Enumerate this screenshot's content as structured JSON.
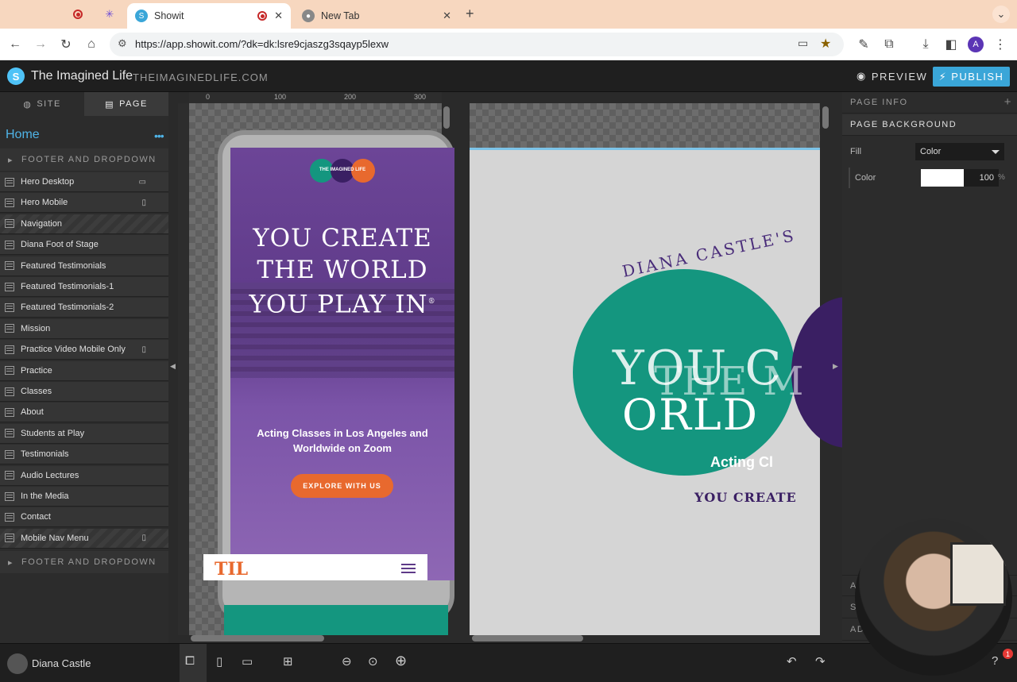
{
  "browser": {
    "tabs": [
      {
        "title": "Showit",
        "active": true
      },
      {
        "title": "New Tab",
        "active": false
      }
    ],
    "url": "https://app.showit.com/?dk=dk:lsre9cjaszg3sqayp5lexw",
    "profile_initial": "A",
    "new_tab_label": "+",
    "tab_menu_label": "⌄"
  },
  "app": {
    "site_name": "The Imagined Life",
    "site_domain": "THEIMAGINEDLIFE.COM",
    "preview_label": "PREVIEW",
    "publish_label": "PUBLISH"
  },
  "sidebar": {
    "tab_site": "SITE",
    "tab_page": "PAGE",
    "current_page": "Home",
    "more": "•••",
    "section_top": "FOOTER AND DROPDOWN",
    "section_bottom": "FOOTER AND DROPDOWN",
    "items": [
      {
        "label": "Hero Desktop",
        "device": "desktop",
        "striped": false
      },
      {
        "label": "Hero Mobile",
        "device": "mobile",
        "striped": false
      },
      {
        "label": "Navigation",
        "device": "",
        "striped": true
      },
      {
        "label": "Diana Foot of Stage",
        "device": "",
        "striped": false
      },
      {
        "label": "Featured Testimonials",
        "device": "",
        "striped": false
      },
      {
        "label": "Featured Testimonials-1",
        "device": "",
        "striped": false
      },
      {
        "label": "Featured Testimonials-2",
        "device": "",
        "striped": false
      },
      {
        "label": "Mission",
        "device": "",
        "striped": false
      },
      {
        "label": "Practice Video Mobile Only",
        "device": "mobile",
        "striped": false
      },
      {
        "label": "Practice",
        "device": "",
        "striped": false
      },
      {
        "label": "Classes",
        "device": "",
        "striped": false
      },
      {
        "label": "About",
        "device": "",
        "striped": false
      },
      {
        "label": "Students at Play",
        "device": "",
        "striped": false
      },
      {
        "label": "Testimonials",
        "device": "",
        "striped": false
      },
      {
        "label": "Audio Lectures",
        "device": "",
        "striped": false
      },
      {
        "label": "In the Media",
        "device": "",
        "striped": false
      },
      {
        "label": "Contact",
        "device": "",
        "striped": false
      },
      {
        "label": "Mobile Nav Menu",
        "device": "mobile",
        "striped": true
      }
    ]
  },
  "canvas": {
    "ruler_marks": [
      "0",
      "100",
      "200",
      "300"
    ],
    "mobile": {
      "logo_text": "THE IMAGINED LIFE",
      "headline": "YOU CREATE THE WORLD YOU PLAY IN",
      "headline_mark": "®",
      "subtitle": "Acting Classes in Los Angeles and Worldwide on Zoom",
      "cta": "EXPLORE WITH US",
      "nav_logo": "TIL"
    },
    "desktop": {
      "arc_text": "DIANA CASTLE'S",
      "big_1": "YOU C",
      "big_2": "THE M",
      "big_3": "ORLD",
      "sub": "Acting Cl",
      "tagline": "YOU CREATE"
    }
  },
  "right_panel": {
    "page_info": "PAGE INFO",
    "page_background": "PAGE BACKGROUND",
    "fill_label": "Fill",
    "fill_value": "Color",
    "color_label": "Color",
    "color_value": "#ffffff",
    "opacity": "100",
    "opacity_unit": "%",
    "collapsed_1": "A",
    "collapsed_2": "S",
    "collapsed_3": "AD",
    "add_label": "+"
  },
  "bottom": {
    "user_name": "Diana Castle",
    "notification_count": "1"
  },
  "colors": {
    "accent": "#3aa6d8",
    "purple": "#5e3a88",
    "orange": "#e8692e",
    "teal": "#14967f"
  }
}
